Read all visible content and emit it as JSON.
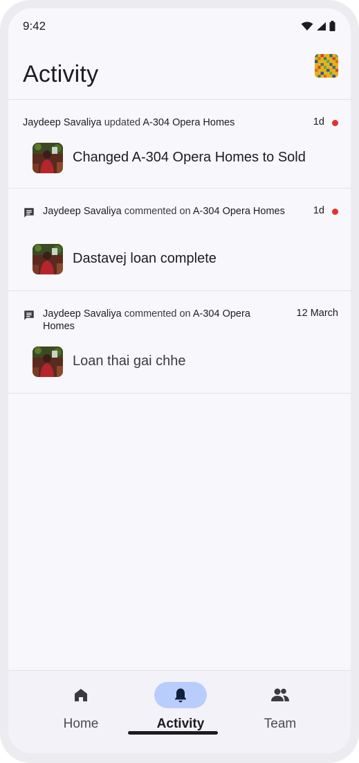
{
  "status_bar": {
    "time": "9:42"
  },
  "header": {
    "title": "Activity"
  },
  "activities": [
    {
      "actor": "Jaydeep Savaliya",
      "verb": "updated",
      "target": "A-304 Opera Homes",
      "time": "1d",
      "unread": true,
      "message": "Changed A-304 Opera Homes to Sold"
    },
    {
      "actor": "Jaydeep Savaliya",
      "verb": "commented on",
      "target": "A-304 Opera Homes",
      "time": "1d",
      "unread": true,
      "message": "Dastavej loan complete"
    },
    {
      "actor": "Jaydeep Savaliya",
      "verb": "commented on",
      "target": "A-304 Opera Homes",
      "time": "12 March",
      "unread": false,
      "message": "Loan thai gai chhe"
    }
  ],
  "bottom_nav": [
    {
      "label": "Home",
      "icon": "home-icon",
      "active": false
    },
    {
      "label": "Activity",
      "icon": "bell-icon",
      "active": true
    },
    {
      "label": "Team",
      "icon": "people-icon",
      "active": false
    }
  ],
  "colors": {
    "background": "#f8f7fc",
    "unread_dot": "#e62e2e",
    "nav_active_pill": "#b9cdfd",
    "text_primary": "#1c1b1f"
  }
}
